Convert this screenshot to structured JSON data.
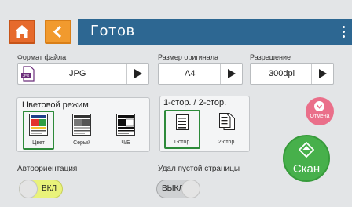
{
  "header": {
    "title": "Готов"
  },
  "format": {
    "label": "Формат файла",
    "value": "JPG",
    "icon_text": "JPG"
  },
  "size": {
    "label": "Размер оригинала",
    "value": "A4"
  },
  "resolution": {
    "label": "Разрешение",
    "value": "300dpi"
  },
  "color_mode": {
    "title": "Цветовой режим",
    "options": [
      {
        "label": "Цвет",
        "selected": true
      },
      {
        "label": "Серый",
        "selected": false
      },
      {
        "label": "Ч/Б",
        "selected": false
      }
    ]
  },
  "sides": {
    "title": "1-стор. / 2-стор.",
    "options": [
      {
        "label": "1-стор.",
        "selected": true
      },
      {
        "label": "2-стор.",
        "selected": false
      }
    ]
  },
  "cancel": {
    "label": "Отмена"
  },
  "scan": {
    "label": "Скан"
  },
  "auto_orient": {
    "label": "Автоориентация",
    "state": "ВКЛ",
    "on": true
  },
  "blank_pages": {
    "label": "Удал пустой страницы",
    "state": "ВЫКЛ",
    "on": false
  },
  "colors": {
    "accent": "#2d6792",
    "home": "#e66a2c",
    "back": "#f19a2e",
    "scan": "#47b04b",
    "cancel": "#ea6f8a",
    "selected": "#2d8a3a"
  }
}
